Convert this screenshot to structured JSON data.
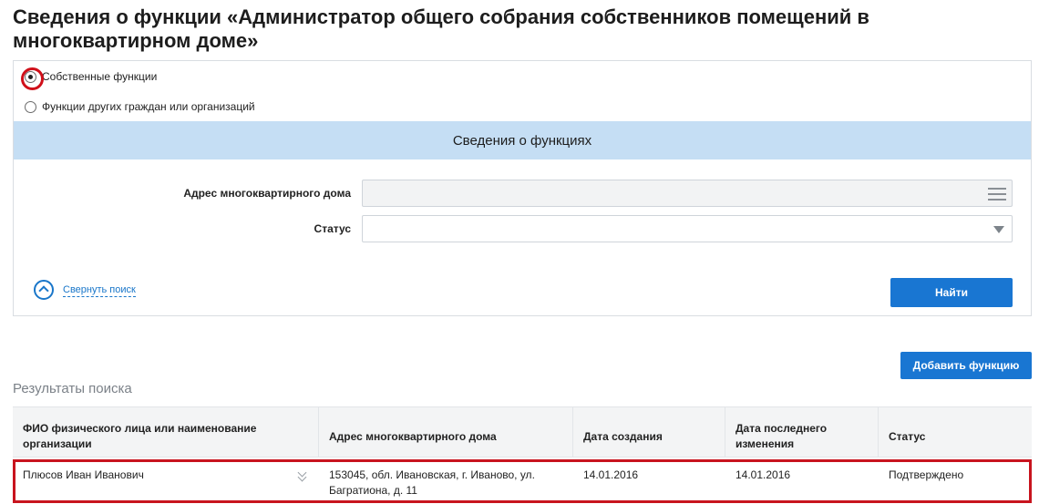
{
  "page": {
    "title": "Сведения о функции «Администратор общего собрания собственников помещений в многоквартирном доме»"
  },
  "filter": {
    "options": [
      {
        "label": "Собственные функции",
        "checked": true
      },
      {
        "label": "Функции других граждан или организаций",
        "checked": false
      }
    ],
    "section_title": "Сведения о функциях",
    "address_label": "Адрес многоквартирного дома",
    "address_value": "",
    "status_label": "Статус",
    "status_value": "",
    "collapse_label": "Свернуть поиск",
    "find_button": "Найти"
  },
  "actions": {
    "add_function": "Добавить функцию"
  },
  "results": {
    "title": "Результаты поиска",
    "columns": [
      "ФИО физического лица или наименование организации",
      "Адрес многоквартирного дома",
      "Дата создания",
      "Дата последнего изменения",
      "Статус"
    ],
    "rows": [
      {
        "name": "Плюсов Иван Иванович",
        "address": "153045, обл. Ивановская, г. Иваново, ул. Багратиона, д. 11",
        "created": "14.01.2016",
        "modified": "14.01.2016",
        "status": "Подтверждено"
      }
    ]
  },
  "colors": {
    "accent": "#1976d2",
    "band": "#c5def4",
    "highlight": "#c8141e"
  },
  "icons": [
    "hamburger-icon",
    "chevron-down-icon",
    "chevron-up-circle-icon",
    "double-chevron-down-icon"
  ]
}
